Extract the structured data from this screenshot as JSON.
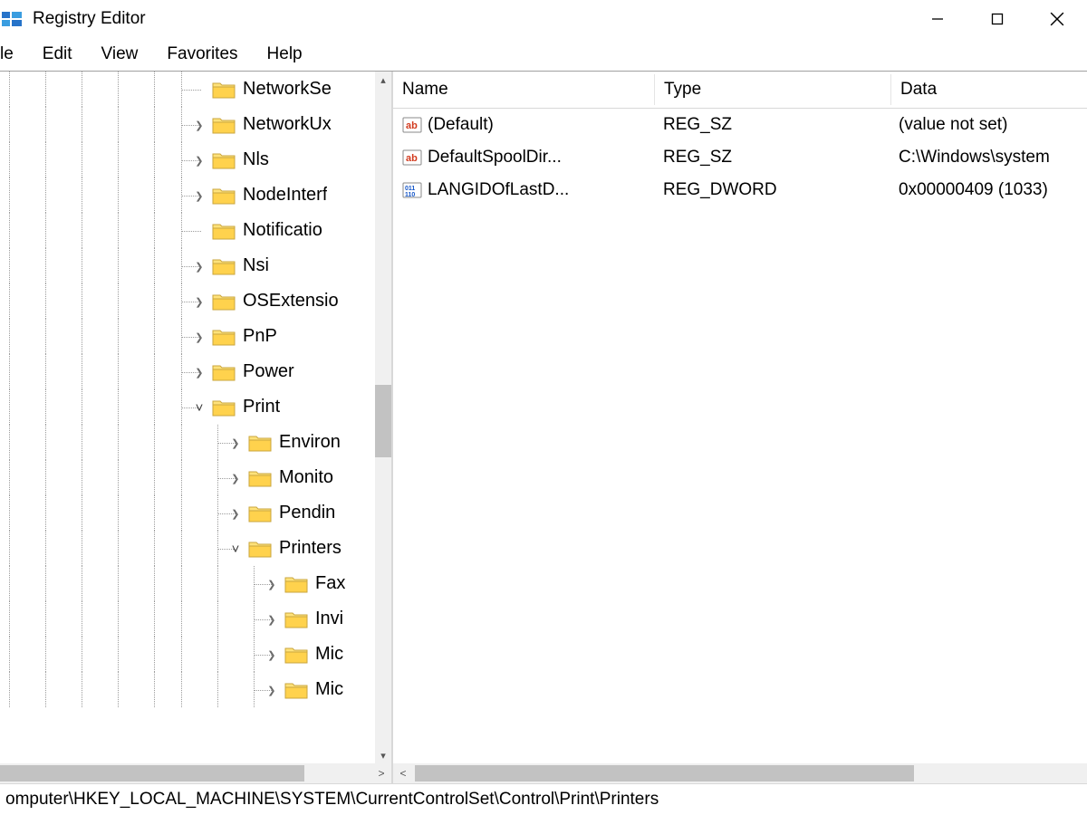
{
  "window": {
    "title": "Registry Editor"
  },
  "menubar": [
    "le",
    "Edit",
    "View",
    "Favorites",
    "Help"
  ],
  "menubar_full_first": "File",
  "tree": {
    "items": [
      {
        "level": 1,
        "expander": "none",
        "label": "NetworkSe",
        "selected": false
      },
      {
        "level": 1,
        "expander": "closed",
        "label": "NetworkUx",
        "selected": false
      },
      {
        "level": 1,
        "expander": "closed",
        "label": "Nls",
        "selected": false
      },
      {
        "level": 1,
        "expander": "closed",
        "label": "NodeInterf",
        "selected": false
      },
      {
        "level": 1,
        "expander": "none",
        "label": "Notificatio",
        "selected": false
      },
      {
        "level": 1,
        "expander": "closed",
        "label": "Nsi",
        "selected": false
      },
      {
        "level": 1,
        "expander": "closed",
        "label": "OSExtensio",
        "selected": false
      },
      {
        "level": 1,
        "expander": "closed",
        "label": "PnP",
        "selected": false
      },
      {
        "level": 1,
        "expander": "closed",
        "label": "Power",
        "selected": false
      },
      {
        "level": 1,
        "expander": "open",
        "label": "Print",
        "selected": false
      },
      {
        "level": 2,
        "expander": "closed",
        "label": "Environ",
        "selected": false
      },
      {
        "level": 2,
        "expander": "closed",
        "label": "Monito",
        "selected": false
      },
      {
        "level": 2,
        "expander": "closed",
        "label": "Pendin",
        "selected": false
      },
      {
        "level": 2,
        "expander": "open",
        "label": "Printers",
        "selected": true
      },
      {
        "level": 3,
        "expander": "closed",
        "label": "Fax",
        "selected": false
      },
      {
        "level": 3,
        "expander": "closed",
        "label": "Invi",
        "selected": false
      },
      {
        "level": 3,
        "expander": "closed",
        "label": "Mic",
        "selected": false
      },
      {
        "level": 3,
        "expander": "closed",
        "label": "Mic",
        "selected": false
      }
    ],
    "scroll": {
      "thumb_top_pct": 45,
      "thumb_height_pct": 11
    }
  },
  "columns": {
    "name": "Name",
    "type": "Type",
    "data": "Data"
  },
  "values": [
    {
      "icon": "sz",
      "name": "(Default)",
      "type": "REG_SZ",
      "data": "(value not set)"
    },
    {
      "icon": "sz",
      "name": "DefaultSpoolDir...",
      "type": "REG_SZ",
      "data": "C:\\Windows\\system"
    },
    {
      "icon": "bin",
      "name": "LANGIDOfLastD...",
      "type": "REG_DWORD",
      "data": "0x00000409 (1033)"
    }
  ],
  "statusbar": "omputer\\HKEY_LOCAL_MACHINE\\SYSTEM\\CurrentControlSet\\Control\\Print\\Printers"
}
